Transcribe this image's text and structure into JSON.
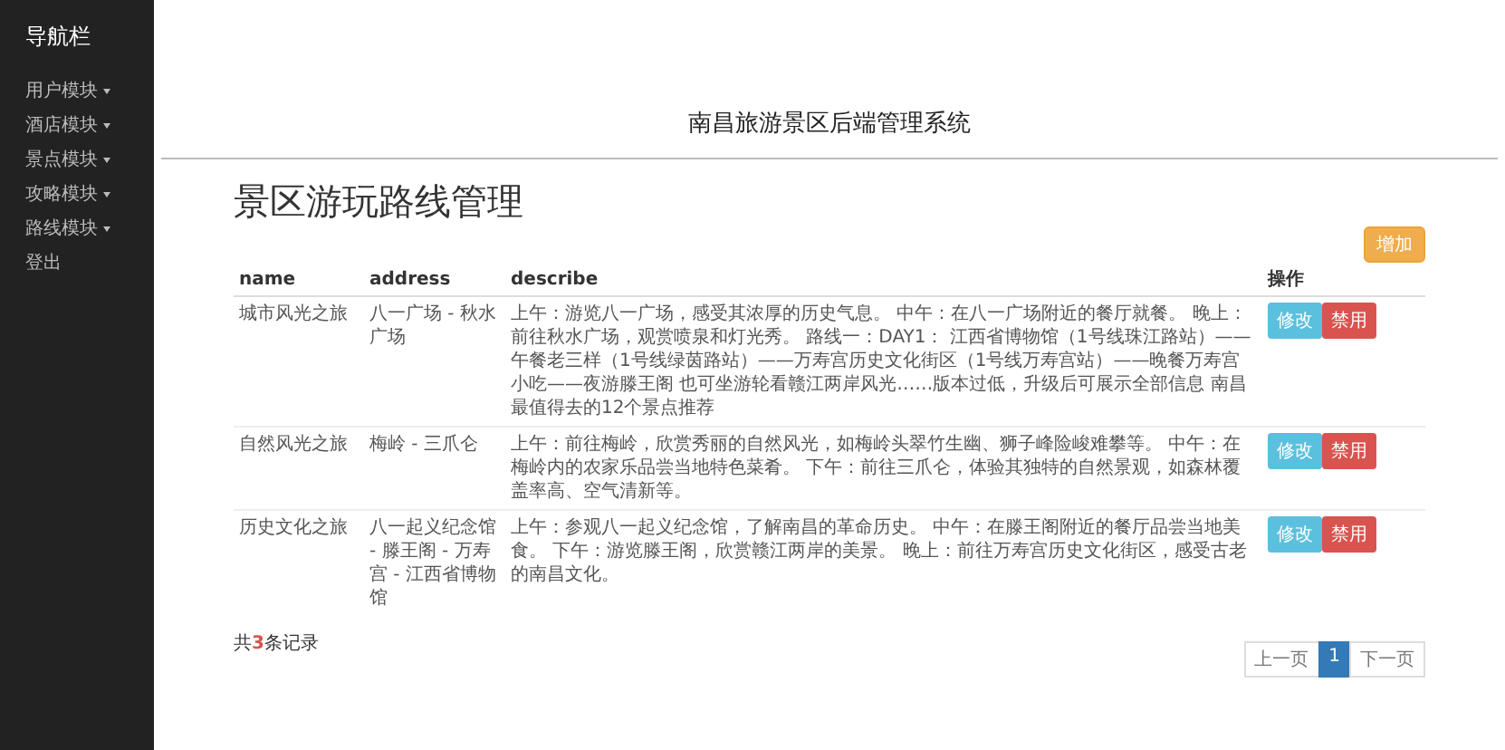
{
  "sidebar": {
    "title": "导航栏",
    "items": [
      {
        "label": "用户模块",
        "kind": "dropdown"
      },
      {
        "label": "酒店模块",
        "kind": "dropdown"
      },
      {
        "label": "景点模块",
        "kind": "dropdown"
      },
      {
        "label": "攻略模块",
        "kind": "dropdown"
      },
      {
        "label": "路线模块",
        "kind": "dropdown"
      },
      {
        "label": "登出",
        "kind": "link"
      }
    ]
  },
  "header": {
    "title": "南昌旅游景区后端管理系统"
  },
  "page_title": "景区游玩路线管理",
  "add_button": "增加",
  "table": {
    "columns": [
      "name",
      "address",
      "describe",
      "操作"
    ],
    "rows": [
      {
        "name": "城市风光之旅",
        "address": "八一广场 - 秋水广场",
        "describe": "上午：游览八一广场，感受其浓厚的历史气息。 中午：在八一广场附近的餐厅就餐。 晚上：前往秋水广场，观赏喷泉和灯光秀。 路线一：DAY1： 江西省博物馆（1号线珠江路站）——午餐老三样（1号线绿茵路站）——万寿宫历史文化街区（1号线万寿宫站）——晚餐万寿宫小吃——夜游滕王阁 也可坐游轮看赣江两岸风光……版本过低，升级后可展示全部信息 南昌最值得去的12个景点推荐",
        "actions": [
          "修改",
          "禁用"
        ]
      },
      {
        "name": "自然风光之旅",
        "address": "梅岭 - 三爪仑",
        "describe": "上午：前往梅岭，欣赏秀丽的自然风光，如梅岭头翠竹生幽、狮子峰险峻难攀等。 中午：在梅岭内的农家乐品尝当地特色菜肴。 下午：前往三爪仑，体验其独特的自然景观，如森林覆盖率高、空气清新等。",
        "actions": [
          "修改",
          "禁用"
        ]
      },
      {
        "name": "历史文化之旅",
        "address": "八一起义纪念馆 - 滕王阁 - 万寿宫 - 江西省博物馆",
        "describe": "上午：参观八一起义纪念馆，了解南昌的革命历史。 中午：在滕王阁附近的餐厅品尝当地美食。 下午：游览滕王阁，欣赏赣江两岸的美景。 晚上：前往万寿宫历史文化街区，感受古老的南昌文化。",
        "actions": [
          "修改",
          "禁用"
        ]
      }
    ]
  },
  "record_count": {
    "prefix": "共",
    "count": "3",
    "suffix": "条记录"
  },
  "pagination": {
    "prev": "上一页",
    "pages": [
      {
        "label": "1",
        "selected": true
      }
    ],
    "next": "下一页"
  }
}
